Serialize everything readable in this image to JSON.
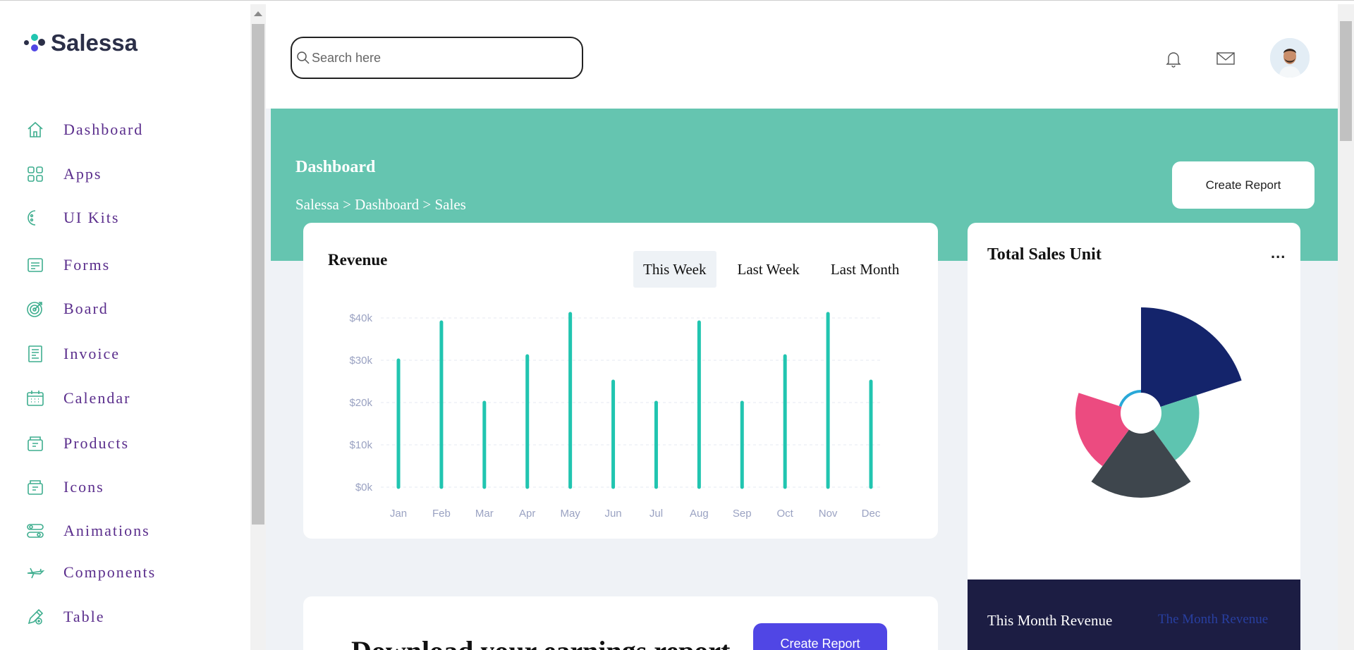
{
  "app": {
    "name": "Salessa"
  },
  "sidebar": {
    "items": [
      {
        "label": "Dashboard",
        "icon": "home-icon"
      },
      {
        "label": "Apps",
        "icon": "apps-grid-icon"
      },
      {
        "label": "UI Kits",
        "icon": "palette-icon"
      },
      {
        "label": "Forms",
        "icon": "form-icon"
      },
      {
        "label": "Board",
        "icon": "target-icon"
      },
      {
        "label": "Invoice",
        "icon": "invoice-icon"
      },
      {
        "label": "Calendar",
        "icon": "calendar-icon"
      },
      {
        "label": "Products",
        "icon": "box-icon"
      },
      {
        "label": "Icons",
        "icon": "box-icon"
      },
      {
        "label": "Animations",
        "icon": "sliders-icon"
      },
      {
        "label": "Components",
        "icon": "plane-icon"
      },
      {
        "label": "Table",
        "icon": "pen-icon"
      }
    ]
  },
  "header": {
    "search_placeholder": "Search here",
    "icons": [
      "bell-icon",
      "mail-icon"
    ]
  },
  "banner": {
    "title": "Dashboard",
    "breadcrumb": "Salessa > Dashboard > Sales",
    "create_report": "Create Report"
  },
  "revenue": {
    "title": "Revenue",
    "tabs": [
      "This Week",
      "Last Week",
      "Last Month"
    ],
    "active_tab": "This Week"
  },
  "chart_data": {
    "type": "bar",
    "categories": [
      "Jan",
      "Feb",
      "Mar",
      "Apr",
      "May",
      "Jun",
      "Jul",
      "Aug",
      "Sep",
      "Oct",
      "Nov",
      "Dec"
    ],
    "values": [
      30,
      39,
      20,
      31,
      41,
      25,
      20,
      39,
      20,
      31,
      41,
      25
    ],
    "ytick_labels": [
      "$0k",
      "$10k",
      "$20k",
      "$30k",
      "$40k"
    ],
    "yticks": [
      0,
      10,
      20,
      30,
      40
    ],
    "ylim": [
      0,
      40
    ],
    "title": "",
    "xlabel": "",
    "ylabel": "",
    "color": "#21c5b0",
    "grid": true
  },
  "sales": {
    "title": "Total Sales Unit",
    "menu": "...",
    "polar_slices": [
      {
        "color": "#14246b",
        "value": 100
      },
      {
        "color": "#5ec4b0",
        "value": 55
      },
      {
        "color": "#3e464d",
        "value": 80
      },
      {
        "color": "#ec4b80",
        "value": 62
      },
      {
        "color": "#29a8d8",
        "value": 22
      }
    ]
  },
  "month_revenue": {
    "label": "This Month Revenue",
    "label2": "The Month Revenue"
  },
  "bottom": {
    "title": "Download your earnings report",
    "button": "Create Report"
  },
  "colors": {
    "accent": "#65c5b0",
    "sidebar_text": "#5a2d8c",
    "primary_button": "#5046e5",
    "dark_panel": "#1c1d43"
  }
}
